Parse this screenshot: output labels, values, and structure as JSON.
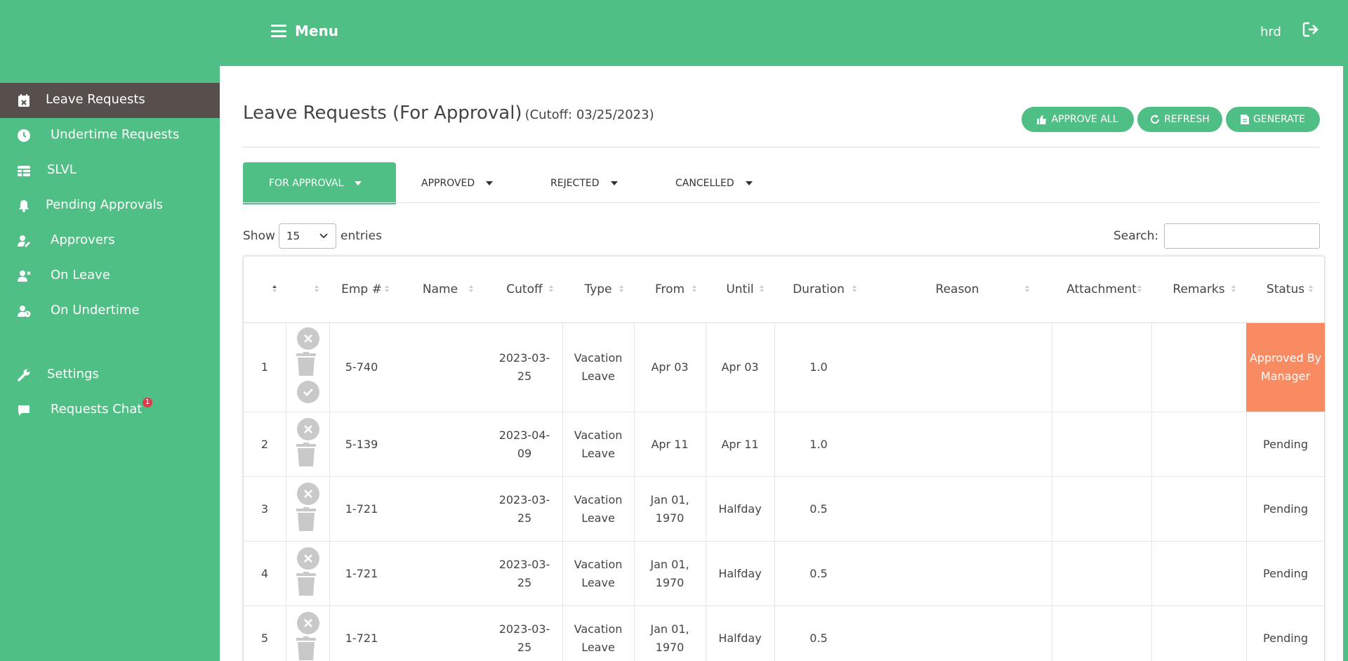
{
  "header": {
    "menu_label": "Menu",
    "user": "hrd"
  },
  "sidebar": {
    "items": [
      {
        "label": "Leave Requests",
        "icon": "calendar-x-icon",
        "active": true
      },
      {
        "label": "Undertime Requests",
        "icon": "clock-icon"
      },
      {
        "label": "SLVL",
        "icon": "table-icon"
      },
      {
        "label": "Pending Approvals",
        "icon": "bell-icon"
      },
      {
        "label": "Approvers",
        "icon": "user-edit-icon"
      },
      {
        "label": "On Leave",
        "icon": "user-times-icon"
      },
      {
        "label": "On Undertime",
        "icon": "user-clock-icon"
      },
      {
        "label": "Settings",
        "icon": "wrench-icon"
      },
      {
        "label": "Requests Chat",
        "icon": "comment-icon",
        "badge": "1"
      }
    ]
  },
  "page": {
    "title": "Leave Requests (For Approval)",
    "cutoff": "(Cutoff: 03/25/2023)",
    "buttons": {
      "approve_all": "APPROVE ALL",
      "refresh": "REFRESH",
      "generate": "GENERATE"
    },
    "tabs": [
      "FOR APPROVAL",
      "APPROVED",
      "REJECTED",
      "CANCELLED"
    ],
    "show_label": "Show",
    "entries_value": "15",
    "entries_label": "entries",
    "search_label": "Search:"
  },
  "table": {
    "headers": [
      "",
      "",
      "Emp #",
      "Name",
      "Cutoff",
      "Type",
      "From",
      "Until",
      "Duration",
      "Reason",
      "Attachment",
      "Remarks",
      "Status"
    ],
    "rows": [
      {
        "num": "1",
        "emp": "5-740",
        "name": "",
        "cutoff": "2023-03-25",
        "type": "Vacation Leave",
        "from": "Apr 03",
        "until": "Apr 03",
        "duration": "1.0",
        "reason": "",
        "attachment": "",
        "remarks": "",
        "status": "Approved By Manager"
      },
      {
        "num": "2",
        "emp": "5-139",
        "name": "",
        "cutoff": "2023-04-09",
        "type": "Vacation Leave",
        "from": "Apr 11",
        "until": "Apr 11",
        "duration": "1.0",
        "reason": "",
        "attachment": "",
        "remarks": "",
        "status": "Pending"
      },
      {
        "num": "3",
        "emp": "1-721",
        "name": "",
        "cutoff": "2023-03-25",
        "type": "Vacation Leave",
        "from": "Jan 01, 1970",
        "until": "Halfday",
        "duration": "0.5",
        "reason": "",
        "attachment": "",
        "remarks": "",
        "status": "Pending"
      },
      {
        "num": "4",
        "emp": "1-721",
        "name": "",
        "cutoff": "2023-03-25",
        "type": "Vacation Leave",
        "from": "Jan 01, 1970",
        "until": "Halfday",
        "duration": "0.5",
        "reason": "",
        "attachment": "",
        "remarks": "",
        "status": "Pending"
      },
      {
        "num": "5",
        "emp": "1-721",
        "name": "",
        "cutoff": "2023-03-25",
        "type": "Vacation Leave",
        "from": "Jan 01, 1970",
        "until": "Halfday",
        "duration": "0.5",
        "reason": "",
        "attachment": "",
        "remarks": "",
        "status": "Pending"
      }
    ]
  },
  "colors": {
    "primary": "#50bf85",
    "active_sidebar": "#564f4c",
    "status_approved": "#f98b62",
    "badge": "#e03c4b"
  }
}
